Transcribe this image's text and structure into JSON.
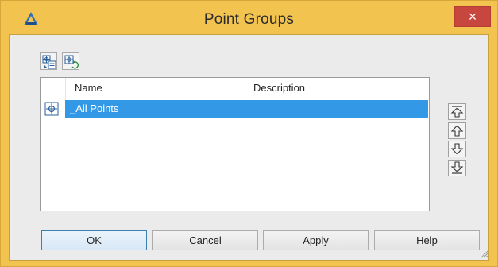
{
  "window": {
    "title": "Point Groups",
    "close_glyph": "×"
  },
  "icons": {
    "app": "autocad-civil-logo-icon",
    "toolbar": [
      "point-group-properties-icon",
      "update-point-groups-icon"
    ],
    "row": "point-group-icon",
    "move": [
      "move-to-top-icon",
      "move-up-icon",
      "move-down-icon",
      "move-to-bottom-icon"
    ]
  },
  "list": {
    "columns": [
      "Name",
      "Description"
    ],
    "rows": [
      {
        "name": "_All Points",
        "description": "",
        "selected": true
      }
    ]
  },
  "buttons": {
    "ok": "OK",
    "cancel": "Cancel",
    "apply": "Apply",
    "help": "Help"
  },
  "colors": {
    "titlebar": "#f3c34f",
    "close": "#c7473f",
    "selection": "#3399e6",
    "client": "#ebebeb"
  }
}
